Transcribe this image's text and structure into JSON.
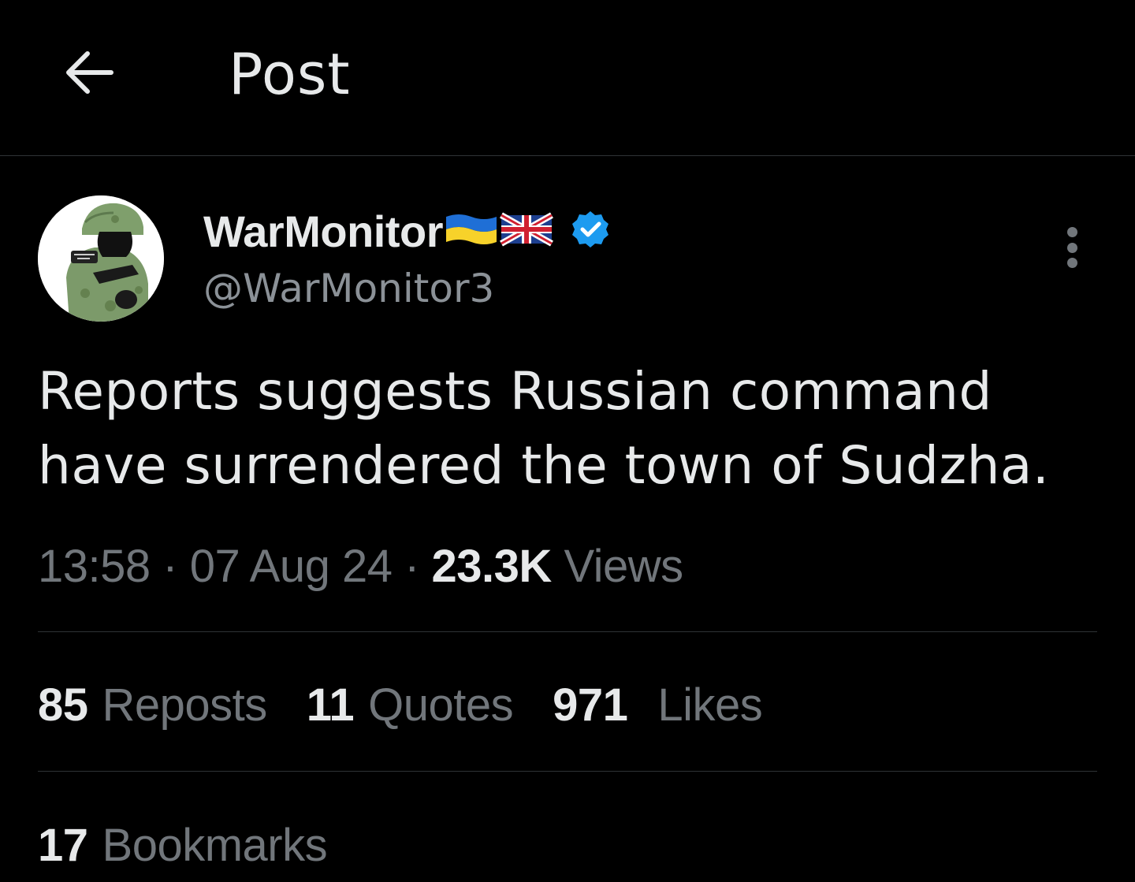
{
  "header": {
    "title": "Post",
    "back_icon": "arrow-left-icon"
  },
  "author": {
    "display_name": "WarMonitor",
    "handle": "@WarMonitor3",
    "flags": [
      "ukraine-flag-icon",
      "uk-flag-icon"
    ],
    "verified_icon": "verified-badge-icon",
    "verified_color": "#1d9bf0"
  },
  "post": {
    "text": "Reports suggests Russian command have surrendered the town of Sudzha."
  },
  "meta": {
    "time": "13:58",
    "date": "07 Aug 24",
    "views_count": "23.3K",
    "views_label": "Views"
  },
  "stats": {
    "reposts_count": "85",
    "reposts_label": "Reposts",
    "quotes_count": "11",
    "quotes_label": "Quotes",
    "likes_count": "971",
    "likes_label": "Likes",
    "bookmarks_count": "17",
    "bookmarks_label": "Bookmarks"
  },
  "colors": {
    "background": "#000000",
    "text_primary": "#e7e9ea",
    "text_secondary": "#71767b",
    "divider": "#2f3336"
  }
}
